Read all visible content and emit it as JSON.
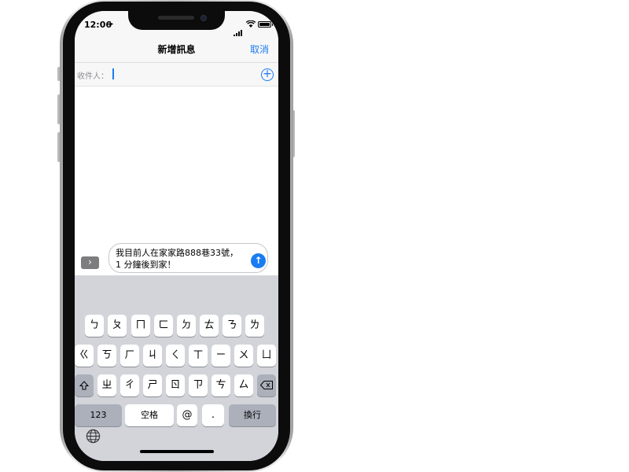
{
  "status_bar": {
    "time": "12:06"
  },
  "nav": {
    "title": "新增訊息",
    "cancel_label": "取消"
  },
  "recipient": {
    "label": "收件人："
  },
  "compose": {
    "text_line1": "我目前人在家家路888巷33號，",
    "text_line2": "1 分鐘後到家！",
    "apps_icon": "chevron-right-icon",
    "send_icon": "arrow-up-icon"
  },
  "keyboard": {
    "row1": [
      "ㄅ",
      "ㄆ",
      "ㄇ",
      "ㄈ",
      "ㄉ",
      "ㄊ",
      "ㄋ",
      "ㄌ"
    ],
    "row2": [
      "ㄍ",
      "ㄎ",
      "ㄏ",
      "ㄐ",
      "ㄑ",
      "ㄒ",
      "ㄧ",
      "ㄨ",
      "ㄩ"
    ],
    "row3": [
      "ㄓ",
      "ㄔ",
      "ㄕ",
      "ㄖ",
      "ㄗ",
      "ㄘ",
      "ㄙ"
    ],
    "numbers_label": "123",
    "space_label": "空格",
    "at_label": "@",
    "dot_label": ".",
    "return_label": "換行",
    "shift_icon": "shift-icon",
    "delete_icon": "delete-icon",
    "globe_icon": "globe-icon"
  },
  "colors": {
    "accent": "#1a7cf2",
    "keyboard_bg": "#d2d4da",
    "dark_key": "#abb0ba"
  }
}
